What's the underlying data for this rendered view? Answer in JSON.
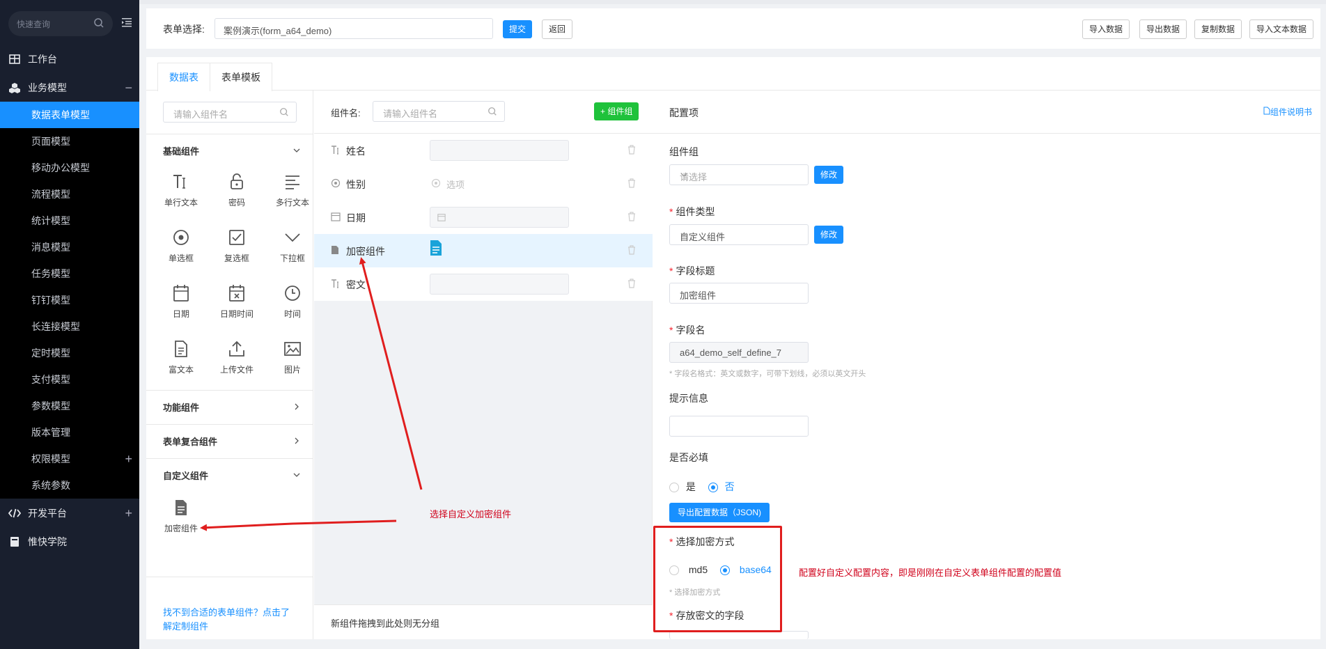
{
  "sidebar": {
    "search_placeholder": "快速查询",
    "items": [
      {
        "label": "工作台"
      },
      {
        "label": "业务模型"
      },
      {
        "label": "开发平台"
      },
      {
        "label": "惟快学院"
      }
    ],
    "sub_items": [
      {
        "label": "数据表单模型"
      },
      {
        "label": "页面模型"
      },
      {
        "label": "移动办公模型"
      },
      {
        "label": "流程模型"
      },
      {
        "label": "统计模型"
      },
      {
        "label": "消息模型"
      },
      {
        "label": "任务模型"
      },
      {
        "label": "钉钉模型"
      },
      {
        "label": "长连接模型"
      },
      {
        "label": "定时模型"
      },
      {
        "label": "支付模型"
      },
      {
        "label": "参数模型"
      },
      {
        "label": "版本管理"
      },
      {
        "label": "权限模型"
      },
      {
        "label": "系统参数"
      }
    ]
  },
  "formbar": {
    "label": "表单选择:",
    "selected": "案例演示(form_a64_demo)",
    "submit": "提交",
    "back": "返回",
    "actions": [
      "导入数据",
      "导出数据",
      "复制数据",
      "导入文本数据"
    ]
  },
  "tabs": [
    "数据表",
    "表单模板"
  ],
  "left": {
    "search_placeholder": "请输入组件名",
    "groups": {
      "basic": "基础组件",
      "function": "功能组件",
      "composite": "表单复合组件",
      "custom": "自定义组件"
    },
    "basic_components": [
      "单行文本",
      "密码",
      "多行文本",
      "单选框",
      "复选框",
      "下拉框",
      "日期",
      "日期时间",
      "时间",
      "富文本",
      "上传文件",
      "图片"
    ],
    "custom_components": [
      "加密组件"
    ],
    "footer_link": "找不到合适的表单组件？点击了解定制组件"
  },
  "middle": {
    "label": "组件名:",
    "search_placeholder": "请输入组件名",
    "add_group": "+ 组件组",
    "rows": [
      {
        "name": "姓名"
      },
      {
        "name": "性别",
        "option": "选项"
      },
      {
        "name": "日期"
      },
      {
        "name": "加密组件"
      },
      {
        "name": "密文"
      }
    ],
    "footer": "新组件拖拽到此处则无分组"
  },
  "config": {
    "title": "配置项",
    "manual": "组件说明书",
    "group_label": "组件组",
    "group_placeholder": "请选择",
    "modify": "修改",
    "type_label": "组件类型",
    "type_value": "自定义组件",
    "field_title_label": "字段标题",
    "field_title_value": "加密组件",
    "field_name_label": "字段名",
    "field_name_value": "a64_demo_self_define_7",
    "field_name_hint": "* 字段名格式：英文或数字，可带下划线，必须以英文开头",
    "tip_label": "提示信息",
    "required_label": "是否必填",
    "yes": "是",
    "no": "否",
    "export_json": "导出配置数据（JSON)",
    "encrypt_label": "选择加密方式",
    "md5": "md5",
    "base64": "base64",
    "encrypt_hint": "* 选择加密方式",
    "cipher_label": "存放密文的字段"
  },
  "annotations": {
    "select_custom": "选择自定义加密组件",
    "configured": "配置好自定义配置内容，即是刚刚在自定义表单组件配置的配置值"
  },
  "colors": {
    "accent": "#1890ff",
    "sidebar": "#191f2e",
    "annotation": "#e01e1e",
    "add_group": "#1fc23b"
  }
}
